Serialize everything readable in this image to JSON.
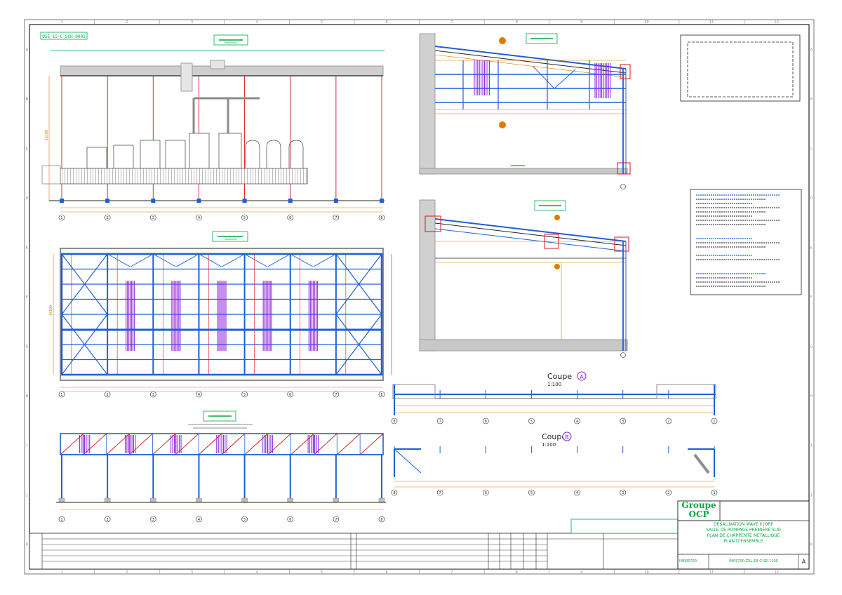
{
  "sheet": {
    "drawing_code_top": "OSE-15-C-SCH-0001",
    "grid_cols": [
      "1",
      "2",
      "3",
      "4",
      "5",
      "6",
      "7",
      "8",
      "9",
      "10",
      "11",
      "12"
    ],
    "grid_rows": [
      "A",
      "B",
      "C",
      "D",
      "E",
      "F",
      "G",
      "H",
      "I",
      "J",
      "K"
    ]
  },
  "views": {
    "axes": [
      "1",
      "2",
      "3",
      "4",
      "5",
      "6",
      "7",
      "8"
    ],
    "coupe_a": {
      "title": "Coupe",
      "letter": "A",
      "scale": "1:100",
      "axes": [
        "8",
        "7",
        "6",
        "5",
        "4",
        "3",
        "2",
        "1"
      ]
    },
    "coupe_b": {
      "title": "Coupe",
      "letter": "B",
      "scale": "1:100",
      "axes": [
        "8",
        "7",
        "6",
        "5",
        "4",
        "3",
        "2",
        "1"
      ]
    }
  },
  "title_block": {
    "company_line1": "Groupe",
    "company_line2": "OCP",
    "project": "DESALINATION WAVE II JORF",
    "subtitle": "SALLE DE POMPAGE PREMIERE SUD",
    "drawing_title_1": "PLAN DE CHARPENTE METALLIQUE",
    "drawing_title_2": "PLAN D'ENSEMBLE",
    "number_1": "IM005700",
    "number_2": "IM05700-ZSL-18-G-SE-1100",
    "revision": "A"
  },
  "colors": {
    "blue": "#1e5fd8",
    "red": "#d8141c",
    "magenta": "#8a1ed8",
    "orange": "#e07a00",
    "green": "#00a844",
    "gray": "#8c8c8c",
    "ink": "#222222"
  }
}
